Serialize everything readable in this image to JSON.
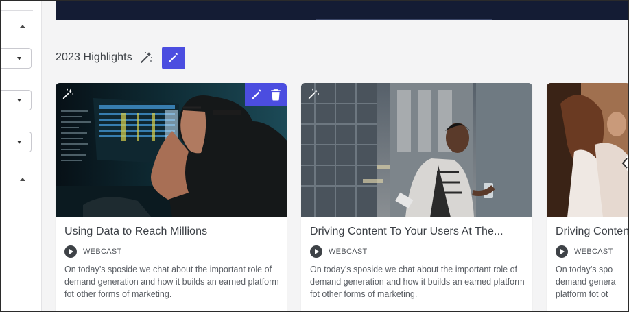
{
  "section": {
    "title": "2023 Highlights"
  },
  "colors": {
    "accent": "#4b4de0",
    "banner": "#141c34"
  },
  "icons": {
    "magic": "magic-wand-icon",
    "edit": "pencil-icon",
    "delete": "trash-icon",
    "play": "play-circle-icon",
    "sort": "caret-up-icon",
    "dropdown": "caret-down-icon"
  },
  "cards": [
    {
      "title": "Using Data to Reach Millions",
      "type": "WEBCAST",
      "description": "On today’s sposide we chat about the important role of demand generation and how it builds an earned platform fot other forms of marketing."
    },
    {
      "title": "Driving Content To Your Users At The...",
      "type": "WEBCAST",
      "description": "On today’s sposide we chat about the important role of demand generation and how it builds an earned platform fot other forms of marketing."
    },
    {
      "title": "Driving Conten",
      "type": "WEBCAST",
      "description": "On today’s spo demand genera platform fot ot"
    }
  ]
}
